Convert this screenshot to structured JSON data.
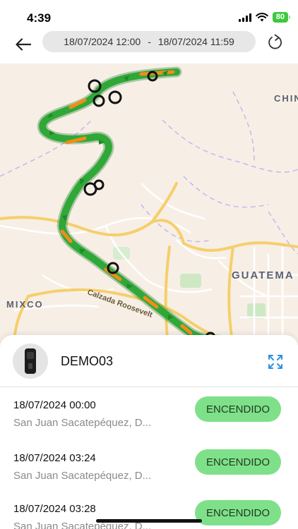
{
  "status_bar": {
    "time": "4:39",
    "battery": "80"
  },
  "header": {
    "back_icon": "arrow-left-icon",
    "date_from": "18/07/2024 12:00",
    "separator": "-",
    "date_to": "18/07/2024 11:59",
    "refresh_icon": "refresh-icon"
  },
  "map": {
    "labels": {
      "china": "CHIN",
      "guatemala": "GUATEMA",
      "mixco": "MIXCO",
      "road": "Calzada Roosevelt"
    },
    "colors": {
      "background": "#f7efe6",
      "route_green": "#2fa838",
      "route_orange": "#f08c1a",
      "major_road": "#f5cf6b",
      "boundary": "#c7b6ea"
    }
  },
  "device": {
    "name": "DEMO03",
    "icon": "device-tracker-icon",
    "expand_icon": "expand-icon"
  },
  "events": [
    {
      "time": "18/07/2024 00:00",
      "address": "San Juan Sacatepéquez, D...",
      "status": "ENCENDIDO"
    },
    {
      "time": "18/07/2024 03:24",
      "address": "San Juan Sacatepéquez, D...",
      "status": "ENCENDIDO"
    },
    {
      "time": "18/07/2024 03:28",
      "address": "San Juan Sacatepéquez, D...",
      "status": "ENCENDIDO"
    }
  ]
}
